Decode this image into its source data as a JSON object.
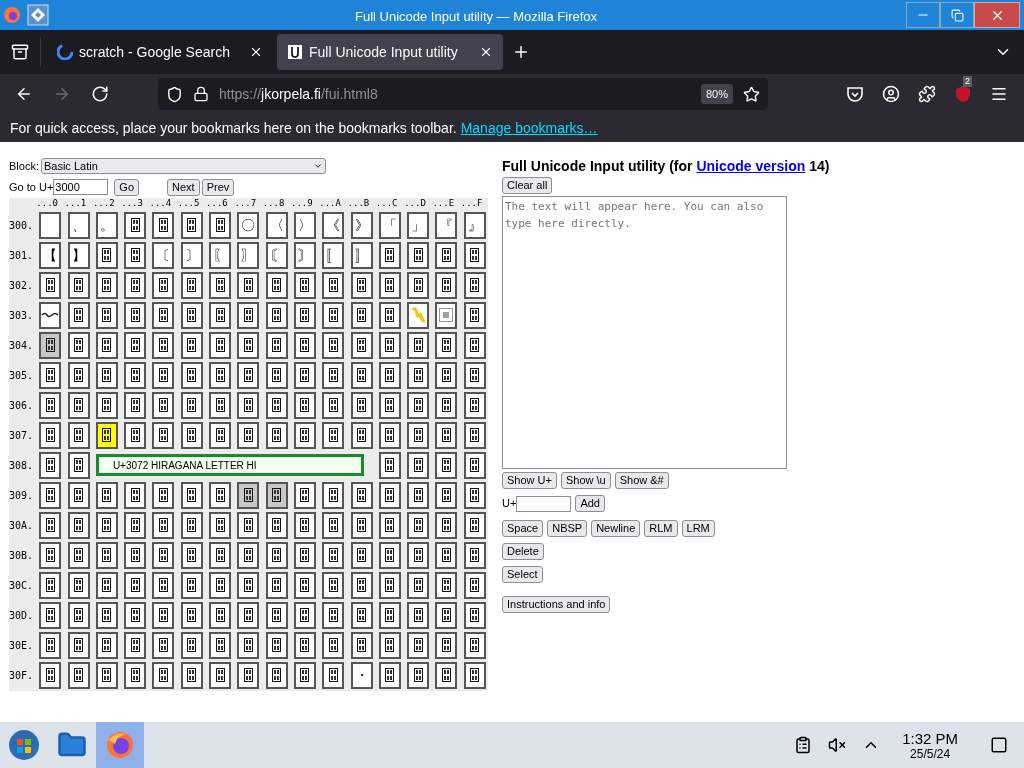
{
  "window": {
    "title": "Full Unicode Input utility — Mozilla Firefox"
  },
  "tabs": [
    {
      "label": "scratch - Google Search",
      "kind": "google",
      "selected": false
    },
    {
      "label": "Full Unicode Input utility",
      "kind": "page",
      "selected": true
    }
  ],
  "nav": [
    {
      "kind": "back",
      "disabled": false
    },
    {
      "kind": "forward",
      "disabled": true
    },
    {
      "kind": "reload",
      "disabled": false
    }
  ],
  "url": {
    "scheme": "https://",
    "host": "jkorpela.fi",
    "path": "/fui.html8"
  },
  "zoom": "80%",
  "extension_badge": "2",
  "bookmarks_bar": {
    "text": "For quick access, place your bookmarks here on the bookmarks toolbar.",
    "link": "Manage bookmarks…"
  },
  "block": {
    "label": "Block:",
    "value": "Basic Latin"
  },
  "goto": {
    "label": "Go to U+",
    "value": "3000",
    "go": "Go",
    "next": "Next",
    "prev": "Prev"
  },
  "grid": {
    "columns": [
      "...0",
      "...1",
      "...2",
      "...3",
      "...4",
      "...5",
      "...6",
      "...7",
      "...8",
      "...9",
      "...A",
      "...B",
      "...C",
      "...D",
      "...E",
      "...F"
    ],
    "rows": [
      {
        "label": "300.",
        "cells": [
          {
            "kind": "blank",
            "shaded": false,
            "hovered": false
          },
          {
            "kind": "glyph",
            "text": "、",
            "shaded": false,
            "hovered": false
          },
          {
            "kind": "glyph",
            "text": "。",
            "shaded": false,
            "hovered": false
          },
          {
            "kind": "missing",
            "shaded": false,
            "hovered": false
          },
          {
            "kind": "missing",
            "shaded": false,
            "hovered": false
          },
          {
            "kind": "missing",
            "shaded": false,
            "hovered": false
          },
          {
            "kind": "missing",
            "shaded": false,
            "hovered": false
          },
          {
            "kind": "glyph",
            "text": "〇",
            "shaded": false,
            "hovered": false
          },
          {
            "kind": "glyph",
            "text": "〈",
            "shaded": false,
            "hovered": false
          },
          {
            "kind": "glyph",
            "text": "〉",
            "shaded": false,
            "hovered": false
          },
          {
            "kind": "glyph",
            "text": "《",
            "shaded": false,
            "hovered": false
          },
          {
            "kind": "glyph",
            "text": "》",
            "shaded": false,
            "hovered": false
          },
          {
            "kind": "glyph",
            "text": "「",
            "shaded": false,
            "hovered": false
          },
          {
            "kind": "glyph",
            "text": "」",
            "shaded": false,
            "hovered": false
          },
          {
            "kind": "glyph",
            "text": "『",
            "shaded": false,
            "hovered": false
          },
          {
            "kind": "glyph",
            "text": "』",
            "shaded": false,
            "hovered": false
          }
        ]
      },
      {
        "label": "301.",
        "cells": [
          {
            "kind": "glyph",
            "text": "【",
            "shaded": false,
            "hovered": false
          },
          {
            "kind": "glyph",
            "text": "】",
            "shaded": false,
            "hovered": false
          },
          {
            "kind": "missing",
            "shaded": false,
            "hovered": false
          },
          {
            "kind": "missing",
            "shaded": false,
            "hovered": false
          },
          {
            "kind": "glyph",
            "text": "〔",
            "shaded": false,
            "hovered": false
          },
          {
            "kind": "glyph",
            "text": "〕",
            "shaded": false,
            "hovered": false
          },
          {
            "kind": "glyph",
            "text": "〖",
            "shaded": false,
            "hovered": false
          },
          {
            "kind": "glyph",
            "text": "〗",
            "shaded": false,
            "hovered": false
          },
          {
            "kind": "glyph",
            "text": "〘",
            "shaded": false,
            "hovered": false
          },
          {
            "kind": "glyph",
            "text": "〙",
            "shaded": false,
            "hovered": false
          },
          {
            "kind": "glyph",
            "text": "〚",
            "shaded": false,
            "hovered": false
          },
          {
            "kind": "glyph",
            "text": "〛",
            "shaded": false,
            "hovered": false
          },
          {
            "kind": "missing",
            "shaded": false,
            "hovered": false
          },
          {
            "kind": "missing",
            "shaded": false,
            "hovered": false
          },
          {
            "kind": "missing",
            "shaded": false,
            "hovered": false
          },
          {
            "kind": "missing",
            "shaded": false,
            "hovered": false
          }
        ]
      },
      {
        "label": "302.",
        "cells": [
          {
            "kind": "missing",
            "shaded": false,
            "hovered": false
          },
          {
            "kind": "missing",
            "shaded": false,
            "hovered": false
          },
          {
            "kind": "missing",
            "shaded": false,
            "hovered": false
          },
          {
            "kind": "missing",
            "shaded": false,
            "hovered": false
          },
          {
            "kind": "missing",
            "shaded": false,
            "hovered": false
          },
          {
            "kind": "missing",
            "shaded": false,
            "hovered": false
          },
          {
            "kind": "missing",
            "shaded": false,
            "hovered": false
          },
          {
            "kind": "missing",
            "shaded": false,
            "hovered": false
          },
          {
            "kind": "missing",
            "shaded": false,
            "hovered": false
          },
          {
            "kind": "missing",
            "shaded": false,
            "hovered": false
          },
          {
            "kind": "missing",
            "shaded": false,
            "hovered": false
          },
          {
            "kind": "missing",
            "shaded": false,
            "hovered": false
          },
          {
            "kind": "missing",
            "shaded": false,
            "hovered": false
          },
          {
            "kind": "missing",
            "shaded": false,
            "hovered": false
          },
          {
            "kind": "missing",
            "shaded": false,
            "hovered": false
          },
          {
            "kind": "missing",
            "shaded": false,
            "hovered": false
          }
        ]
      },
      {
        "label": "303.",
        "cells": [
          {
            "kind": "wave",
            "shaded": false,
            "hovered": false
          },
          {
            "kind": "missing",
            "shaded": false,
            "hovered": false
          },
          {
            "kind": "missing",
            "shaded": false,
            "hovered": false
          },
          {
            "kind": "missing",
            "shaded": false,
            "hovered": false
          },
          {
            "kind": "missing",
            "shaded": false,
            "hovered": false
          },
          {
            "kind": "missing",
            "shaded": false,
            "hovered": false
          },
          {
            "kind": "missing",
            "shaded": false,
            "hovered": false
          },
          {
            "kind": "missing",
            "shaded": false,
            "hovered": false
          },
          {
            "kind": "missing",
            "shaded": false,
            "hovered": false
          },
          {
            "kind": "missing",
            "shaded": false,
            "hovered": false
          },
          {
            "kind": "missing",
            "shaded": false,
            "hovered": false
          },
          {
            "kind": "missing",
            "shaded": false,
            "hovered": false
          },
          {
            "kind": "missing",
            "shaded": false,
            "hovered": false
          },
          {
            "kind": "zigzag",
            "shaded": false,
            "hovered": false
          },
          {
            "kind": "framed",
            "shaded": false,
            "hovered": false
          },
          {
            "kind": "missing",
            "shaded": false,
            "hovered": false
          }
        ]
      },
      {
        "label": "304.",
        "cells": [
          {
            "kind": "missing",
            "shaded": true,
            "hovered": false
          },
          {
            "kind": "missing",
            "shaded": false,
            "hovered": false
          },
          {
            "kind": "missing",
            "shaded": false,
            "hovered": false
          },
          {
            "kind": "missing",
            "shaded": false,
            "hovered": false
          },
          {
            "kind": "missing",
            "shaded": false,
            "hovered": false
          },
          {
            "kind": "missing",
            "shaded": false,
            "hovered": false
          },
          {
            "kind": "missing",
            "shaded": false,
            "hovered": false
          },
          {
            "kind": "missing",
            "shaded": false,
            "hovered": false
          },
          {
            "kind": "missing",
            "shaded": false,
            "hovered": false
          },
          {
            "kind": "missing",
            "shaded": false,
            "hovered": false
          },
          {
            "kind": "missing",
            "shaded": false,
            "hovered": false
          },
          {
            "kind": "missing",
            "shaded": false,
            "hovered": false
          },
          {
            "kind": "missing",
            "shaded": false,
            "hovered": false
          },
          {
            "kind": "missing",
            "shaded": false,
            "hovered": false
          },
          {
            "kind": "missing",
            "shaded": false,
            "hovered": false
          },
          {
            "kind": "missing",
            "shaded": false,
            "hovered": false
          }
        ]
      },
      {
        "label": "305.",
        "cells": [
          {
            "kind": "missing",
            "shaded": false,
            "hovered": false
          },
          {
            "kind": "missing",
            "shaded": false,
            "hovered": false
          },
          {
            "kind": "missing",
            "shaded": false,
            "hovered": false
          },
          {
            "kind": "missing",
            "shaded": false,
            "hovered": false
          },
          {
            "kind": "missing",
            "shaded": false,
            "hovered": false
          },
          {
            "kind": "missing",
            "shaded": false,
            "hovered": false
          },
          {
            "kind": "missing",
            "shaded": false,
            "hovered": false
          },
          {
            "kind": "missing",
            "shaded": false,
            "hovered": false
          },
          {
            "kind": "missing",
            "shaded": false,
            "hovered": false
          },
          {
            "kind": "missing",
            "shaded": false,
            "hovered": false
          },
          {
            "kind": "missing",
            "shaded": false,
            "hovered": false
          },
          {
            "kind": "missing",
            "shaded": false,
            "hovered": false
          },
          {
            "kind": "missing",
            "shaded": false,
            "hovered": false
          },
          {
            "kind": "missing",
            "shaded": false,
            "hovered": false
          },
          {
            "kind": "missing",
            "shaded": false,
            "hovered": false
          },
          {
            "kind": "missing",
            "shaded": false,
            "hovered": false
          }
        ]
      },
      {
        "label": "306.",
        "cells": [
          {
            "kind": "missing",
            "shaded": false,
            "hovered": false
          },
          {
            "kind": "missing",
            "shaded": false,
            "hovered": false
          },
          {
            "kind": "missing",
            "shaded": false,
            "hovered": false
          },
          {
            "kind": "missing",
            "shaded": false,
            "hovered": false
          },
          {
            "kind": "missing",
            "shaded": false,
            "hovered": false
          },
          {
            "kind": "missing",
            "shaded": false,
            "hovered": false
          },
          {
            "kind": "missing",
            "shaded": false,
            "hovered": false
          },
          {
            "kind": "missing",
            "shaded": false,
            "hovered": false
          },
          {
            "kind": "missing",
            "shaded": false,
            "hovered": false
          },
          {
            "kind": "missing",
            "shaded": false,
            "hovered": false
          },
          {
            "kind": "missing",
            "shaded": false,
            "hovered": false
          },
          {
            "kind": "missing",
            "shaded": false,
            "hovered": false
          },
          {
            "kind": "missing",
            "shaded": false,
            "hovered": false
          },
          {
            "kind": "missing",
            "shaded": false,
            "hovered": false
          },
          {
            "kind": "missing",
            "shaded": false,
            "hovered": false
          },
          {
            "kind": "missing",
            "shaded": false,
            "hovered": false
          }
        ]
      },
      {
        "label": "307.",
        "cells": [
          {
            "kind": "missing",
            "shaded": false,
            "hovered": false
          },
          {
            "kind": "missing",
            "shaded": false,
            "hovered": false
          },
          {
            "kind": "missing",
            "shaded": false,
            "hovered": true
          },
          {
            "kind": "missing",
            "shaded": false,
            "hovered": false
          },
          {
            "kind": "missing",
            "shaded": false,
            "hovered": false
          },
          {
            "kind": "missing",
            "shaded": false,
            "hovered": false
          },
          {
            "kind": "missing",
            "shaded": false,
            "hovered": false
          },
          {
            "kind": "missing",
            "shaded": false,
            "hovered": false
          },
          {
            "kind": "missing",
            "shaded": false,
            "hovered": false
          },
          {
            "kind": "missing",
            "shaded": false,
            "hovered": false
          },
          {
            "kind": "missing",
            "shaded": false,
            "hovered": false
          },
          {
            "kind": "missing",
            "shaded": false,
            "hovered": false
          },
          {
            "kind": "missing",
            "shaded": false,
            "hovered": false
          },
          {
            "kind": "missing",
            "shaded": false,
            "hovered": false
          },
          {
            "kind": "missing",
            "shaded": false,
            "hovered": false
          },
          {
            "kind": "missing",
            "shaded": false,
            "hovered": false
          }
        ]
      },
      {
        "label": "308.",
        "cells": [
          {
            "kind": "missing",
            "shaded": false,
            "hovered": false
          },
          {
            "kind": "missing",
            "shaded": false,
            "hovered": false
          }
        ],
        "tooltip": "U+3072 HIRAGANA LETTER HI",
        "cells_after": [
          {
            "kind": "missing",
            "shaded": false,
            "hovered": false
          },
          {
            "kind": "missing",
            "shaded": false,
            "hovered": false
          },
          {
            "kind": "missing",
            "shaded": false,
            "hovered": false
          },
          {
            "kind": "missing",
            "shaded": false,
            "hovered": false
          }
        ]
      },
      {
        "label": "309.",
        "cells": [
          {
            "kind": "missing",
            "shaded": false,
            "hovered": false
          },
          {
            "kind": "missing",
            "shaded": false,
            "hovered": false
          },
          {
            "kind": "missing",
            "shaded": false,
            "hovered": false
          },
          {
            "kind": "missing",
            "shaded": false,
            "hovered": false
          },
          {
            "kind": "missing",
            "shaded": false,
            "hovered": false
          },
          {
            "kind": "missing",
            "shaded": false,
            "hovered": false
          },
          {
            "kind": "missing",
            "shaded": false,
            "hovered": false
          },
          {
            "kind": "missing",
            "shaded": true,
            "hovered": false
          },
          {
            "kind": "missing",
            "shaded": true,
            "hovered": false
          },
          {
            "kind": "missing",
            "shaded": false,
            "hovered": false
          },
          {
            "kind": "missing",
            "shaded": false,
            "hovered": false
          },
          {
            "kind": "missing",
            "shaded": false,
            "hovered": false
          },
          {
            "kind": "missing",
            "shaded": false,
            "hovered": false
          },
          {
            "kind": "missing",
            "shaded": false,
            "hovered": false
          },
          {
            "kind": "missing",
            "shaded": false,
            "hovered": false
          },
          {
            "kind": "missing",
            "shaded": false,
            "hovered": false
          }
        ]
      },
      {
        "label": "30A.",
        "cells": [
          {
            "kind": "missing",
            "shaded": false,
            "hovered": false
          },
          {
            "kind": "missing",
            "shaded": false,
            "hovered": false
          },
          {
            "kind": "missing",
            "shaded": false,
            "hovered": false
          },
          {
            "kind": "missing",
            "shaded": false,
            "hovered": false
          },
          {
            "kind": "missing",
            "shaded": false,
            "hovered": false
          },
          {
            "kind": "missing",
            "shaded": false,
            "hovered": false
          },
          {
            "kind": "missing",
            "shaded": false,
            "hovered": false
          },
          {
            "kind": "missing",
            "shaded": false,
            "hovered": false
          },
          {
            "kind": "missing",
            "shaded": false,
            "hovered": false
          },
          {
            "kind": "missing",
            "shaded": false,
            "hovered": false
          },
          {
            "kind": "missing",
            "shaded": false,
            "hovered": false
          },
          {
            "kind": "missing",
            "shaded": false,
            "hovered": false
          },
          {
            "kind": "missing",
            "shaded": false,
            "hovered": false
          },
          {
            "kind": "missing",
            "shaded": false,
            "hovered": false
          },
          {
            "kind": "missing",
            "shaded": false,
            "hovered": false
          },
          {
            "kind": "missing",
            "shaded": false,
            "hovered": false
          }
        ]
      },
      {
        "label": "30B.",
        "cells": [
          {
            "kind": "missing",
            "shaded": false,
            "hovered": false
          },
          {
            "kind": "missing",
            "shaded": false,
            "hovered": false
          },
          {
            "kind": "missing",
            "shaded": false,
            "hovered": false
          },
          {
            "kind": "missing",
            "shaded": false,
            "hovered": false
          },
          {
            "kind": "missing",
            "shaded": false,
            "hovered": false
          },
          {
            "kind": "missing",
            "shaded": false,
            "hovered": false
          },
          {
            "kind": "missing",
            "shaded": false,
            "hovered": false
          },
          {
            "kind": "missing",
            "shaded": false,
            "hovered": false
          },
          {
            "kind": "missing",
            "shaded": false,
            "hovered": false
          },
          {
            "kind": "missing",
            "shaded": false,
            "hovered": false
          },
          {
            "kind": "missing",
            "shaded": false,
            "hovered": false
          },
          {
            "kind": "missing",
            "shaded": false,
            "hovered": false
          },
          {
            "kind": "missing",
            "shaded": false,
            "hovered": false
          },
          {
            "kind": "missing",
            "shaded": false,
            "hovered": false
          },
          {
            "kind": "missing",
            "shaded": false,
            "hovered": false
          },
          {
            "kind": "missing",
            "shaded": false,
            "hovered": false
          }
        ]
      },
      {
        "label": "30C.",
        "cells": [
          {
            "kind": "missing",
            "shaded": false,
            "hovered": false
          },
          {
            "kind": "missing",
            "shaded": false,
            "hovered": false
          },
          {
            "kind": "missing",
            "shaded": false,
            "hovered": false
          },
          {
            "kind": "missing",
            "shaded": false,
            "hovered": false
          },
          {
            "kind": "missing",
            "shaded": false,
            "hovered": false
          },
          {
            "kind": "missing",
            "shaded": false,
            "hovered": false
          },
          {
            "kind": "missing",
            "shaded": false,
            "hovered": false
          },
          {
            "kind": "missing",
            "shaded": false,
            "hovered": false
          },
          {
            "kind": "missing",
            "shaded": false,
            "hovered": false
          },
          {
            "kind": "missing",
            "shaded": false,
            "hovered": false
          },
          {
            "kind": "missing",
            "shaded": false,
            "hovered": false
          },
          {
            "kind": "missing",
            "shaded": false,
            "hovered": false
          },
          {
            "kind": "missing",
            "shaded": false,
            "hovered": false
          },
          {
            "kind": "missing",
            "shaded": false,
            "hovered": false
          },
          {
            "kind": "missing",
            "shaded": false,
            "hovered": false
          },
          {
            "kind": "missing",
            "shaded": false,
            "hovered": false
          }
        ]
      },
      {
        "label": "30D.",
        "cells": [
          {
            "kind": "missing",
            "shaded": false,
            "hovered": false
          },
          {
            "kind": "missing",
            "shaded": false,
            "hovered": false
          },
          {
            "kind": "missing",
            "shaded": false,
            "hovered": false
          },
          {
            "kind": "missing",
            "shaded": false,
            "hovered": false
          },
          {
            "kind": "missing",
            "shaded": false,
            "hovered": false
          },
          {
            "kind": "missing",
            "shaded": false,
            "hovered": false
          },
          {
            "kind": "missing",
            "shaded": false,
            "hovered": false
          },
          {
            "kind": "missing",
            "shaded": false,
            "hovered": false
          },
          {
            "kind": "missing",
            "shaded": false,
            "hovered": false
          },
          {
            "kind": "missing",
            "shaded": false,
            "hovered": false
          },
          {
            "kind": "missing",
            "shaded": false,
            "hovered": false
          },
          {
            "kind": "missing",
            "shaded": false,
            "hovered": false
          },
          {
            "kind": "missing",
            "shaded": false,
            "hovered": false
          },
          {
            "kind": "missing",
            "shaded": false,
            "hovered": false
          },
          {
            "kind": "missing",
            "shaded": false,
            "hovered": false
          },
          {
            "kind": "missing",
            "shaded": false,
            "hovered": false
          }
        ]
      },
      {
        "label": "30E.",
        "cells": [
          {
            "kind": "missing",
            "shaded": false,
            "hovered": false
          },
          {
            "kind": "missing",
            "shaded": false,
            "hovered": false
          },
          {
            "kind": "missing",
            "shaded": false,
            "hovered": false
          },
          {
            "kind": "missing",
            "shaded": false,
            "hovered": false
          },
          {
            "kind": "missing",
            "shaded": false,
            "hovered": false
          },
          {
            "kind": "missing",
            "shaded": false,
            "hovered": false
          },
          {
            "kind": "missing",
            "shaded": false,
            "hovered": false
          },
          {
            "kind": "missing",
            "shaded": false,
            "hovered": false
          },
          {
            "kind": "missing",
            "shaded": false,
            "hovered": false
          },
          {
            "kind": "missing",
            "shaded": false,
            "hovered": false
          },
          {
            "kind": "missing",
            "shaded": false,
            "hovered": false
          },
          {
            "kind": "missing",
            "shaded": false,
            "hovered": false
          },
          {
            "kind": "missing",
            "shaded": false,
            "hovered": false
          },
          {
            "kind": "missing",
            "shaded": false,
            "hovered": false
          },
          {
            "kind": "missing",
            "shaded": false,
            "hovered": false
          },
          {
            "kind": "missing",
            "shaded": false,
            "hovered": false
          }
        ]
      },
      {
        "label": "30F.",
        "cells": [
          {
            "kind": "missing",
            "shaded": false,
            "hovered": false
          },
          {
            "kind": "missing",
            "shaded": false,
            "hovered": false
          },
          {
            "kind": "missing",
            "shaded": false,
            "hovered": false
          },
          {
            "kind": "missing",
            "shaded": false,
            "hovered": false
          },
          {
            "kind": "missing",
            "shaded": false,
            "hovered": false
          },
          {
            "kind": "missing",
            "shaded": false,
            "hovered": false
          },
          {
            "kind": "missing",
            "shaded": false,
            "hovered": false
          },
          {
            "kind": "missing",
            "shaded": false,
            "hovered": false
          },
          {
            "kind": "missing",
            "shaded": false,
            "hovered": false
          },
          {
            "kind": "missing",
            "shaded": false,
            "hovered": false
          },
          {
            "kind": "missing",
            "shaded": false,
            "hovered": false
          },
          {
            "kind": "glyph",
            "text": "・",
            "shaded": false,
            "hovered": false
          },
          {
            "kind": "missing",
            "shaded": false,
            "hovered": false
          },
          {
            "kind": "missing",
            "shaded": false,
            "hovered": false
          },
          {
            "kind": "missing",
            "shaded": false,
            "hovered": false
          },
          {
            "kind": "missing",
            "shaded": false,
            "hovered": false
          }
        ]
      }
    ]
  },
  "panel": {
    "title": "Full Unicode Input utility (for ",
    "title_link": "Unicode version",
    "title_end": " 14)",
    "clear": "Clear all",
    "placeholder": "The text will appear here. You can also type here directly.",
    "show_buttons": [
      "Show U+",
      "Show \\u",
      "Show &#"
    ],
    "add": {
      "label": "U+",
      "button": "Add"
    },
    "insert_buttons": [
      "Space",
      "NBSP",
      "Newline",
      "RLM",
      "LRM"
    ],
    "delete": "Delete",
    "select": "Select",
    "info": "Instructions and info"
  },
  "taskbar": {
    "apps": [
      {
        "kind": "start",
        "selected": false
      },
      {
        "kind": "files",
        "selected": false
      },
      {
        "kind": "firefox",
        "selected": true
      }
    ],
    "time": "1:32 PM",
    "date": "25/5/24"
  }
}
